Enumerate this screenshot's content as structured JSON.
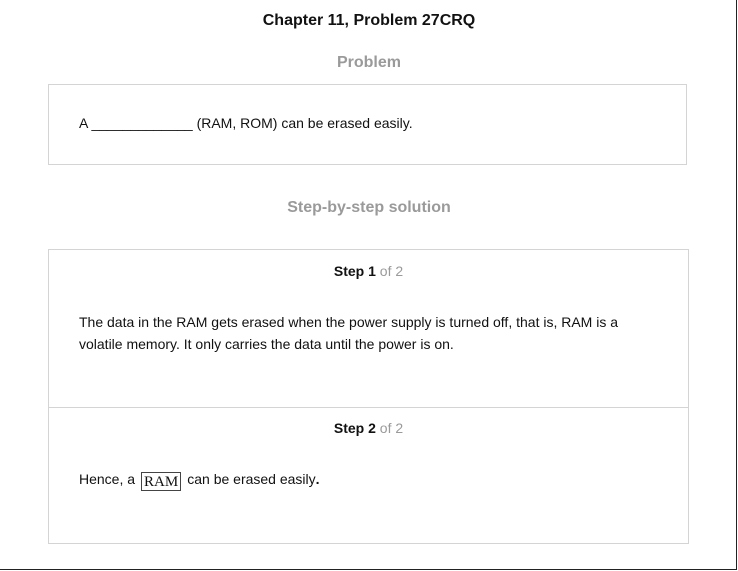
{
  "header": {
    "title": "Chapter 11, Problem 27CRQ"
  },
  "problem": {
    "heading": "Problem",
    "text": "A _____________ (RAM, ROM) can be erased easily."
  },
  "solution": {
    "heading": "Step-by-step solution",
    "steps": [
      {
        "word": "Step",
        "number": "1",
        "of_text": "of 2",
        "body": "The data in the RAM gets erased when the power supply is turned off, that is, RAM is a volatile memory. It only carries the data until the power is on."
      },
      {
        "word": "Step",
        "number": "2",
        "of_text": "of 2",
        "prefix": "Hence, a",
        "answer": "RAM",
        "suffix": "can be erased easily",
        "period": "."
      }
    ]
  }
}
